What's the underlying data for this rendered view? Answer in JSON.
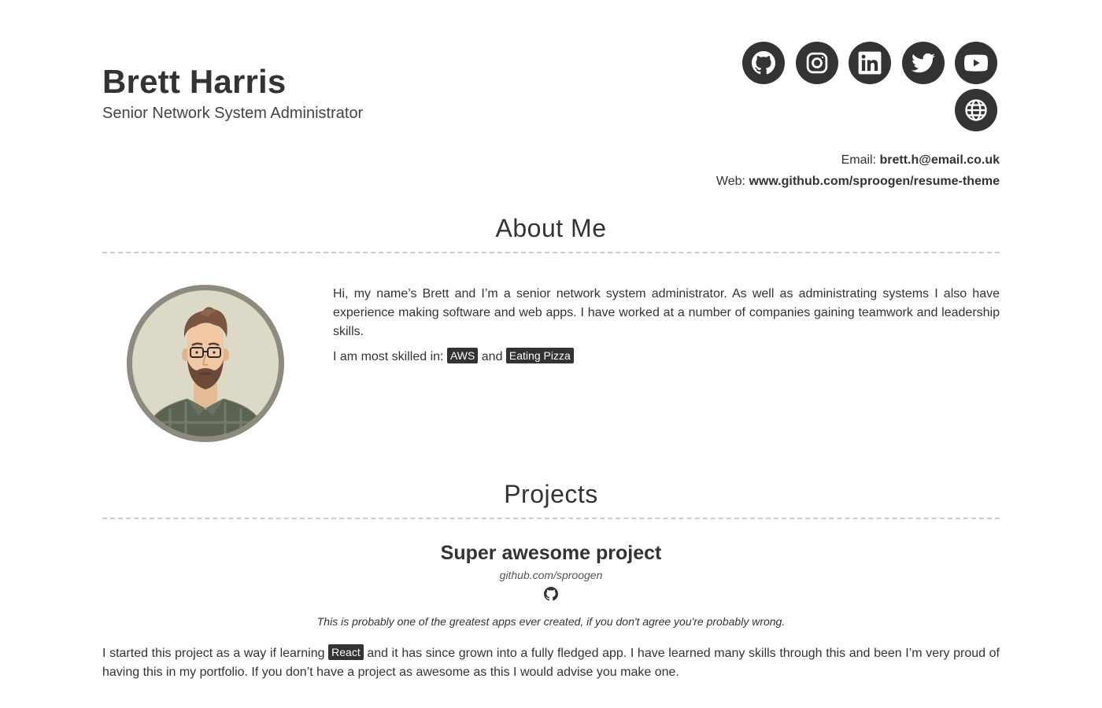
{
  "header": {
    "name": "Brett Harris",
    "title": "Senior Network System Administrator"
  },
  "social": {
    "github_label": "github-icon",
    "instagram_label": "instagram-icon",
    "linkedin_label": "linkedin-icon",
    "twitter_label": "twitter-icon",
    "youtube_label": "youtube-icon",
    "website_label": "globe-icon"
  },
  "contact": {
    "email_label": "Email:",
    "email": "brett.h@email.co.uk",
    "web_label": "Web:",
    "web": "www.github.com/sproogen/resume-theme"
  },
  "about": {
    "heading": "About Me",
    "bio": "Hi, my name’s Brett and I’m a senior network system administrator. As well as administrating systems I also have experience making software and web apps. I have worked at a number of companies gaining teamwork and leadership skills.",
    "skills_intro": "I am most skilled in:",
    "skills": [
      "AWS",
      "Eating Pizza"
    ],
    "skills_joiner": "and"
  },
  "projects": {
    "heading": "Projects",
    "items": [
      {
        "name": "Super awesome project",
        "link": "github.com/sproogen",
        "tagline": "This is probably one of the greatest apps ever created, if you don't agree you're probably wrong.",
        "desc_before": "I started this project as a way if learning",
        "tag": "React",
        "desc_after": "and it has since grown into a fully fledged app. I have learned many skills through this and been I’m very proud of having this in my portfolio. If you don’t have a project as awesome as this I would advise you make one."
      }
    ]
  },
  "colors": {
    "primary": "#333333",
    "rule": "#cccccc",
    "avatar_bg": "#dcd9c6"
  }
}
